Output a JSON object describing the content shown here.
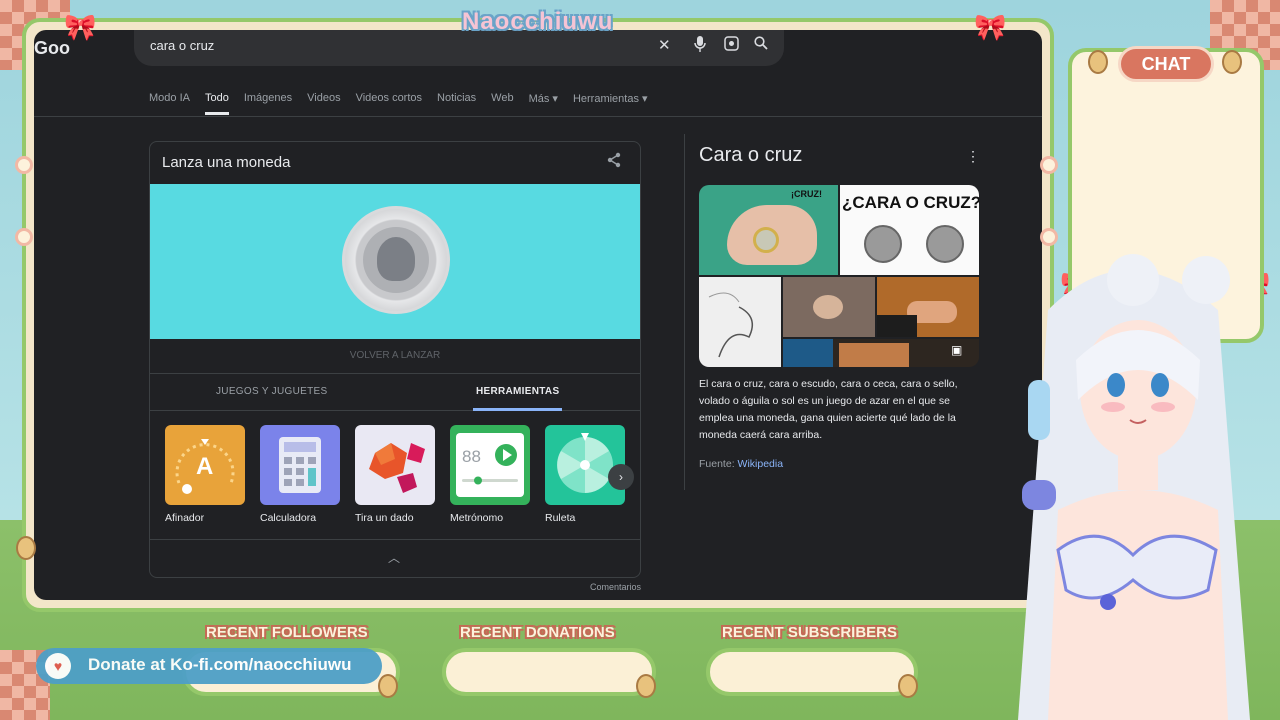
{
  "overlay": {
    "logo": "Naocchiuwu",
    "chat_label": "CHAT",
    "widgets": {
      "followers": "RECENT FOLLOWERS",
      "donations": "RECENT DONATIONS",
      "subscribers": "RECENT SUBSCRIBERS"
    },
    "kofi_text": "Donate at Ko-fi.com/naocchiuwu",
    "colors": {
      "frame_green": "#95c86a",
      "accent_red": "#d97660",
      "cream": "#fdf3dd",
      "kofi_blue": "#4e9fc7"
    }
  },
  "google": {
    "logo_partial": "Goo",
    "search_query": "cara o cruz",
    "search_icons": [
      "close-icon",
      "mic-icon",
      "lens-icon",
      "search-icon"
    ],
    "tabs": [
      {
        "label": "Modo IA",
        "active": false
      },
      {
        "label": "Todo",
        "active": true
      },
      {
        "label": "Imágenes",
        "active": false
      },
      {
        "label": "Videos",
        "active": false
      },
      {
        "label": "Videos cortos",
        "active": false
      },
      {
        "label": "Noticias",
        "active": false
      },
      {
        "label": "Web",
        "active": false
      },
      {
        "label": "Más ▾",
        "active": false
      },
      {
        "label": "Herramientas ▾",
        "active": false
      }
    ],
    "coin_card": {
      "title": "Lanza una moneda",
      "flip_label": "VOLVER A LANZAR",
      "section_tabs": [
        "JUEGOS Y JUGUETES",
        "HERRAMIENTAS"
      ],
      "active_section": "HERRAMIENTAS",
      "tools": [
        {
          "label": "Afinador",
          "tile_text": "A",
          "color": "#e8a33a"
        },
        {
          "label": "Calculadora",
          "tile_text": "",
          "color": "#7b83ea"
        },
        {
          "label": "Tira un dado",
          "tile_text": "",
          "color": "#e9e8f3"
        },
        {
          "label": "Metrónomo",
          "tile_text": "88",
          "color": "#34b25b"
        },
        {
          "label": "Ruleta",
          "tile_text": "",
          "color": "#23c49a"
        }
      ],
      "comments": "Comentarios"
    },
    "knowledge_panel": {
      "title": "Cara o cruz",
      "image_caption_1": "¡CRUZ!",
      "image_caption_2": "¿CARA O CRUZ?",
      "description": "El cara o cruz, cara o escudo, cara o ceca,  cara o sello, volado o águila o sol es un juego de azar en el que se emplea una moneda, gana quien acierte qué lado de la moneda caerá cara arriba.",
      "source_label": "Fuente:",
      "source_link": "Wikipedia"
    }
  }
}
